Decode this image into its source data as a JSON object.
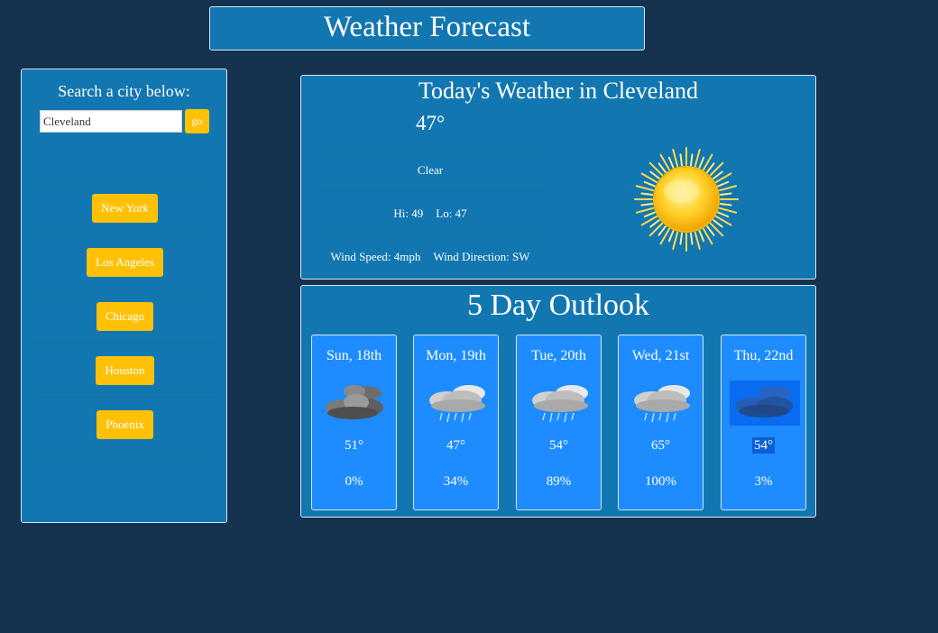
{
  "header": {
    "title": "Weather Forecast"
  },
  "sidebar": {
    "search_label": "Search a city below:",
    "search_value": "Cleveland",
    "go_label": "go",
    "cities": [
      {
        "label": "New York"
      },
      {
        "label": "Los Angeles"
      },
      {
        "label": "Chicago"
      },
      {
        "label": "Houston"
      },
      {
        "label": "Phoenix"
      }
    ]
  },
  "today": {
    "title": "Today's Weather in Cleveland",
    "temp": "47°",
    "condition": "Clear",
    "hi": "Hi: 49",
    "lo": "Lo: 47",
    "wind_speed": "Wind Speed: 4mph",
    "wind_direction": "Wind Direction: SW",
    "icon": "sun-icon"
  },
  "outlook": {
    "title": "5 Day Outlook",
    "days": [
      {
        "name": "Sun, 18th",
        "temp": "51°",
        "precip": "0%",
        "icon": "dark-clouds-icon"
      },
      {
        "name": "Mon, 19th",
        "temp": "47°",
        "precip": "34%",
        "icon": "rain-cloud-icon"
      },
      {
        "name": "Tue, 20th",
        "temp": "54°",
        "precip": "89%",
        "icon": "rain-cloud-icon"
      },
      {
        "name": "Wed, 21st",
        "temp": "65°",
        "precip": "100%",
        "icon": "rain-cloud-icon"
      },
      {
        "name": "Thu, 22nd",
        "temp": "54°",
        "precip": "3%",
        "icon": "selected-clouds-icon"
      }
    ]
  },
  "colors": {
    "background": "#15324f",
    "panel": "#1277b1",
    "card": "#1e8cff",
    "button": "#ffc107"
  }
}
